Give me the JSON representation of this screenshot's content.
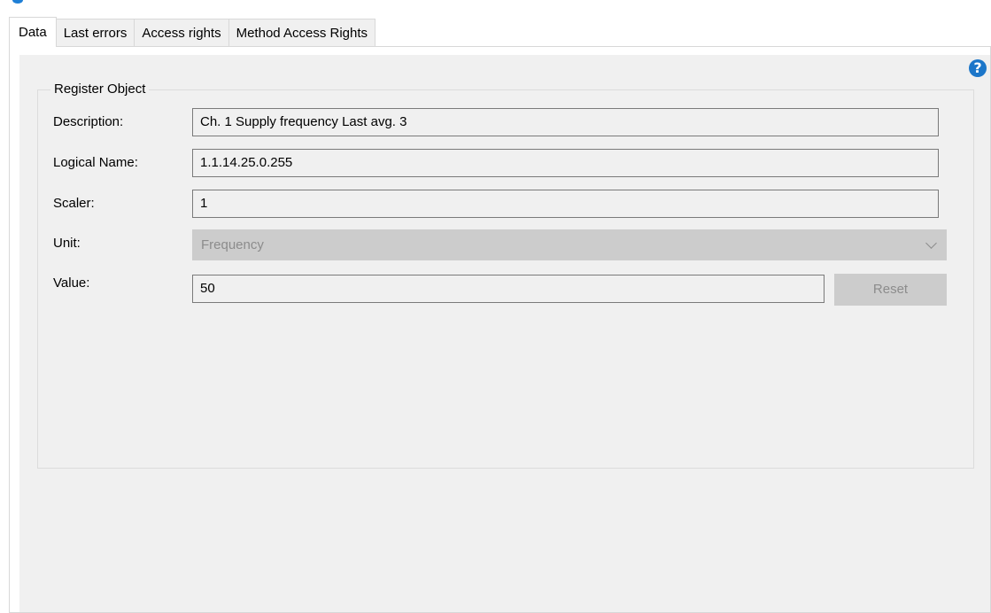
{
  "tabs": [
    {
      "label": "Data",
      "active": true
    },
    {
      "label": "Last errors",
      "active": false
    },
    {
      "label": "Access rights",
      "active": false
    },
    {
      "label": "Method Access Rights",
      "active": false
    }
  ],
  "help_icon": {
    "glyph": "?",
    "icon": "help-icon"
  },
  "register_object": {
    "group_title": "Register Object",
    "description": {
      "label": "Description:",
      "value": "Ch. 1 Supply frequency Last avg. 3"
    },
    "logical_name": {
      "label": "Logical Name:",
      "value": "1.1.14.25.0.255"
    },
    "scaler": {
      "label": "Scaler:",
      "value": "1"
    },
    "unit": {
      "label": "Unit:",
      "value": "Frequency",
      "enabled": false
    },
    "value": {
      "label": "Value:",
      "value": "50"
    },
    "reset_label": "Reset"
  },
  "colors": {
    "panel_background": "#f0f0f0",
    "help_icon": "#1c76c9",
    "disabled_control": "#cccccc",
    "disabled_text": "#8c8c8c"
  }
}
